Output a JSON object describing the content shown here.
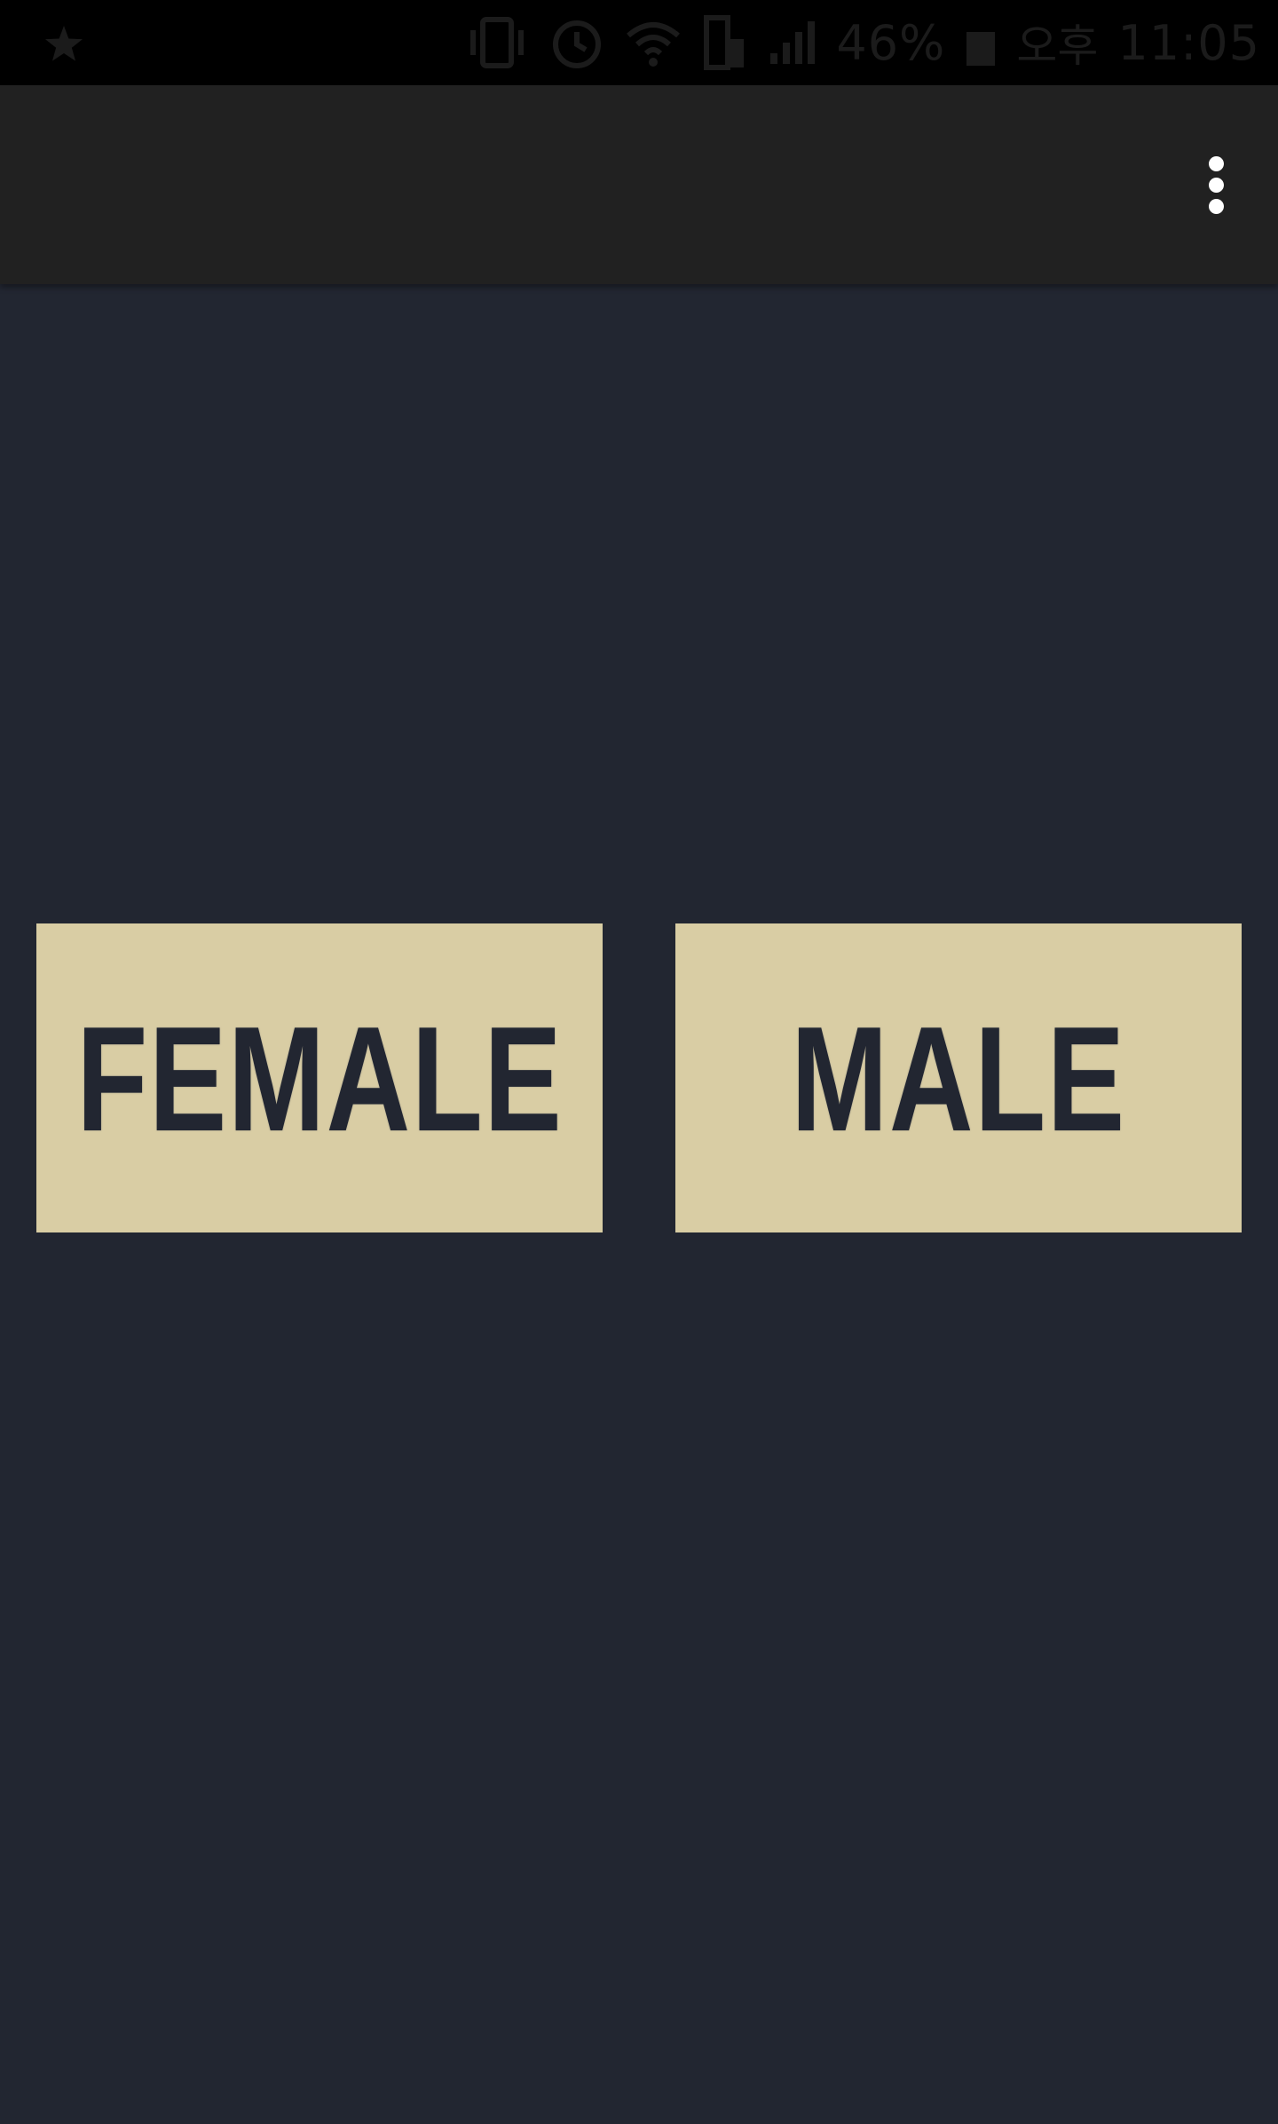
{
  "status_bar": {
    "left_icon": "star-icon",
    "icons": [
      "vibrate-icon",
      "alarm-icon",
      "wifi-icon",
      "data-transfer-icon",
      "signal-icon",
      "battery-icon"
    ],
    "battery_percent": "46%",
    "ampm": "오후",
    "time": "11:05"
  },
  "app_bar": {
    "overflow_icon": "more-vert-icon"
  },
  "choices": {
    "female_label": "FEMALE",
    "male_label": "MALE"
  },
  "colors": {
    "background": "#222631",
    "app_bar": "#212121",
    "status_bar": "#000000",
    "button": "#d9cda4",
    "button_text": "#222631"
  }
}
